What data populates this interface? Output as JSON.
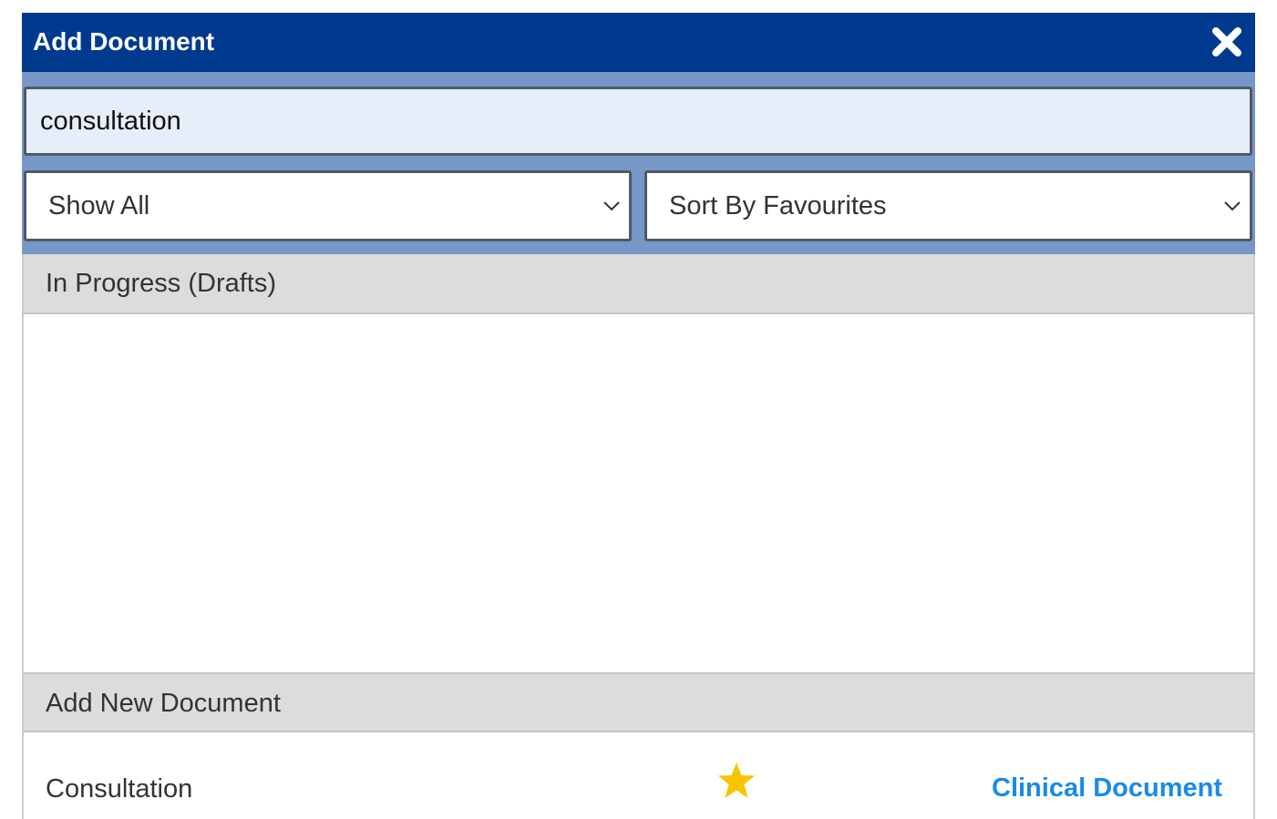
{
  "dialog": {
    "title": "Add Document",
    "close_icon": "close-icon"
  },
  "search": {
    "value": "consultation",
    "placeholder": ""
  },
  "filters": {
    "show": {
      "selected": "Show All"
    },
    "sort": {
      "selected": "Sort By Favourites"
    }
  },
  "sections": {
    "drafts": {
      "label": "In Progress (Drafts)"
    },
    "new": {
      "label": "Add New Document"
    }
  },
  "documents": [
    {
      "name": "Consultation",
      "favourite": true,
      "favourite_icon": "star-icon",
      "type": "Clinical Document"
    }
  ],
  "colors": {
    "titlebar": "#003a8f",
    "panel": "#7897c9",
    "search_bg": "#e6eef9",
    "section_bg": "#dcdcdc",
    "star": "#f7c600",
    "link": "#1a8be8"
  }
}
